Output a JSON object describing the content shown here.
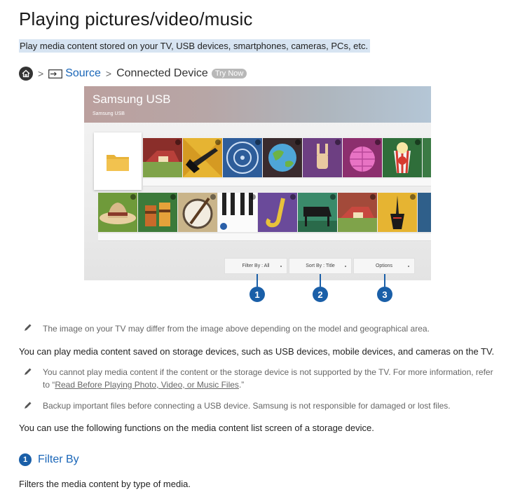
{
  "page": {
    "title": "Playing pictures/video/music",
    "intro": "Play media content stored on your TV, USB devices, smartphones, cameras, PCs, etc."
  },
  "breadcrumb": {
    "home_icon": "home-icon",
    "source_icon": "source-icon",
    "source_label": "Source",
    "location_label": "Connected Device",
    "try_now_label": "Try Now"
  },
  "tv_screen": {
    "title": "Samsung USB",
    "subtitle": "Samsung USB",
    "buttons": {
      "filter": "Filter By : All",
      "sort": "Sort By : Title",
      "options": "Options"
    },
    "callouts": [
      "1",
      "2",
      "3"
    ]
  },
  "notes": {
    "image_note": "The image on your TV may differ from the image above depending on the model and geographical area.",
    "support_note_line1": "You cannot play media content if the content or the storage device is not supported by the TV. For more information, refer",
    "support_note_prefix": "to “",
    "support_note_link": "Read Before Playing Photo, Video, or Music Files",
    "support_note_suffix": ".”",
    "backup_note": "Backup important files before connecting a USB device. Samsung is not responsible for damaged or lost files."
  },
  "body": {
    "para1": "You can play media content saved on storage devices, such as USB devices, mobile devices, and cameras on the TV.",
    "para2": "You can use the following functions on the media content list screen of a storage device."
  },
  "section": {
    "number": "1",
    "title": "Filter By",
    "description": "Filters the media content by type of media."
  },
  "colors": {
    "accent": "#1a5fa8",
    "link": "#1a66b8",
    "highlight": "#d7e4f2"
  }
}
